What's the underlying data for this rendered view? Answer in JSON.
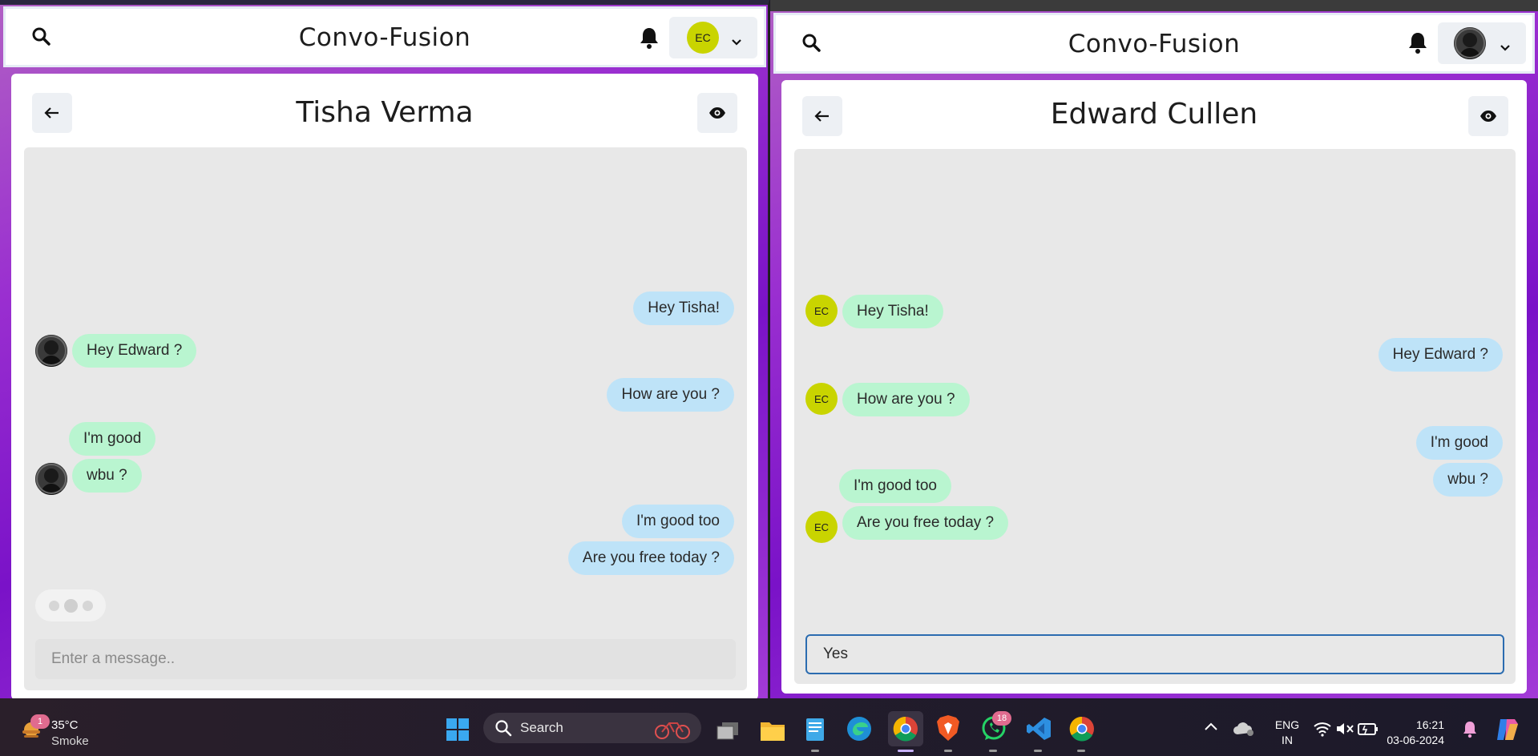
{
  "app_title": "Convo-Fusion",
  "left_window": {
    "user_initials": "EC",
    "chat_title": "Tisha Verma",
    "messages": [
      {
        "text": "Hey Tisha!",
        "direction": "out"
      },
      {
        "text": "Hey Edward ?",
        "direction": "in"
      },
      {
        "text": "How are you ?",
        "direction": "out"
      },
      {
        "text": "I'm good",
        "direction": "in"
      },
      {
        "text": "wbu ?",
        "direction": "in"
      },
      {
        "text": "I'm good too",
        "direction": "out"
      },
      {
        "text": "Are you free today ?",
        "direction": "out"
      }
    ],
    "input_placeholder": "Enter a message.."
  },
  "right_window": {
    "chat_title": "Edward Cullen",
    "sender_initials": "EC",
    "messages": [
      {
        "text": "Hey Tisha!",
        "direction": "in"
      },
      {
        "text": "Hey Edward ?",
        "direction": "out"
      },
      {
        "text": "How are you ?",
        "direction": "in"
      },
      {
        "text": "I'm good",
        "direction": "out"
      },
      {
        "text": "wbu ?",
        "direction": "out"
      },
      {
        "text": "I'm good too",
        "direction": "in"
      },
      {
        "text": "Are you free today ?",
        "direction": "in"
      }
    ],
    "input_value": "Yes"
  },
  "taskbar": {
    "weather_badge": "1",
    "weather_temp": "35°C",
    "weather_desc": "Smoke",
    "search_label": "Search",
    "whatsapp_badge": "18",
    "language_line1": "ENG",
    "language_line2": "IN",
    "time": "16:21",
    "date": "03-06-2024"
  },
  "colors": {
    "outgoing_bubble": "#bee3f8",
    "incoming_bubble": "#b9f5d0",
    "avatar_ec": "#c9d400",
    "input_focus_border": "#2b6cb0"
  }
}
